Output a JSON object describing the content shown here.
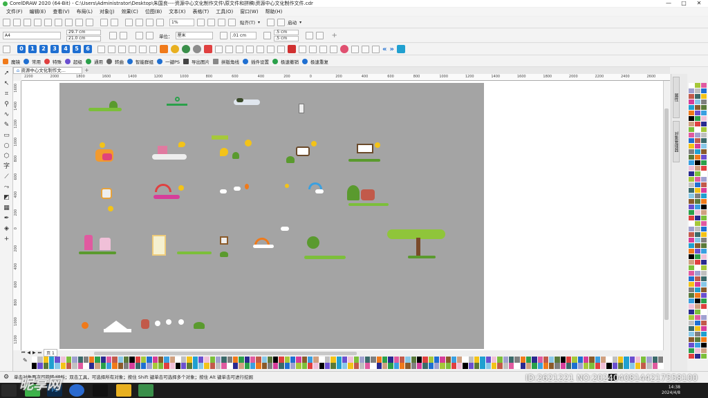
{
  "app": {
    "title": "CorelDRAW 2020 (64-Bit) - C:\\Users\\Administrator\\Desktop\\朱国良----资源中心文化制作文件\\原文件和拼稿\\资源中心文化制作文件.cdr",
    "window_controls": [
      "—",
      "□",
      "✕"
    ]
  },
  "menu": [
    "文件(F)",
    "编辑(E)",
    "查看(V)",
    "布局(L)",
    "对象(J)",
    "效果(C)",
    "位图(B)",
    "文本(X)",
    "表格(T)",
    "工具(O)",
    "窗口(W)",
    "帮助(H)"
  ],
  "toolbar": {
    "zoom": "1%",
    "snap": "贴齐(T)",
    "launch": "启动"
  },
  "property_bar": {
    "page_size": "A4",
    "width": "29.7 cm",
    "height": "21.0 cm",
    "units_label": "单位：",
    "units": "厘米",
    "nudge": ".01 cm",
    "dup_x": ".5 cm",
    "dup_y": ".5 cm"
  },
  "number_buttons": [
    "0",
    "1",
    "2",
    "3",
    "4",
    "5",
    "6"
  ],
  "plugin_bar": [
    "魔镜",
    "常用",
    "特殊",
    "超级",
    "通用",
    "转曲",
    "智能群组",
    "一键PS",
    "导出图片",
    "拼版角线",
    "插件设置",
    "极速撤销",
    "极速重复"
  ],
  "doc_tab": "资源中心文化制作文...",
  "ruler_top": [
    "2200",
    "2000",
    "1800",
    "1600",
    "1400",
    "1200",
    "1000",
    "800",
    "600",
    "400",
    "200",
    "0",
    "200",
    "400",
    "600",
    "800",
    "1000",
    "1200",
    "1400",
    "1600",
    "1800",
    "2000",
    "2200",
    "2400",
    "2600"
  ],
  "ruler_left": [
    "1600",
    "1400",
    "1200",
    "1000",
    "800",
    "600",
    "400",
    "200",
    "0",
    "200",
    "400",
    "600",
    "800",
    "1000",
    "1200"
  ],
  "page_tab": "页 1",
  "dockers": [
    "属性",
    "对象管理器"
  ],
  "status": "单击对象两次可旋转/倾斜；双击工具，可选择所有对象；按住 Shift 键单击可选择多个对象；按住 Alt 键单击可进行挖掘",
  "watermark_id": "ID:2621221 NO:20240408144217558100",
  "watermark_logo": "昵享网",
  "clock": {
    "time": "14:38",
    "date": "2024/4/8"
  },
  "colors": {
    "accent": "#1f6fd1",
    "page_bg": "#a4a4a4",
    "canvas_bg": "#ffffff"
  }
}
